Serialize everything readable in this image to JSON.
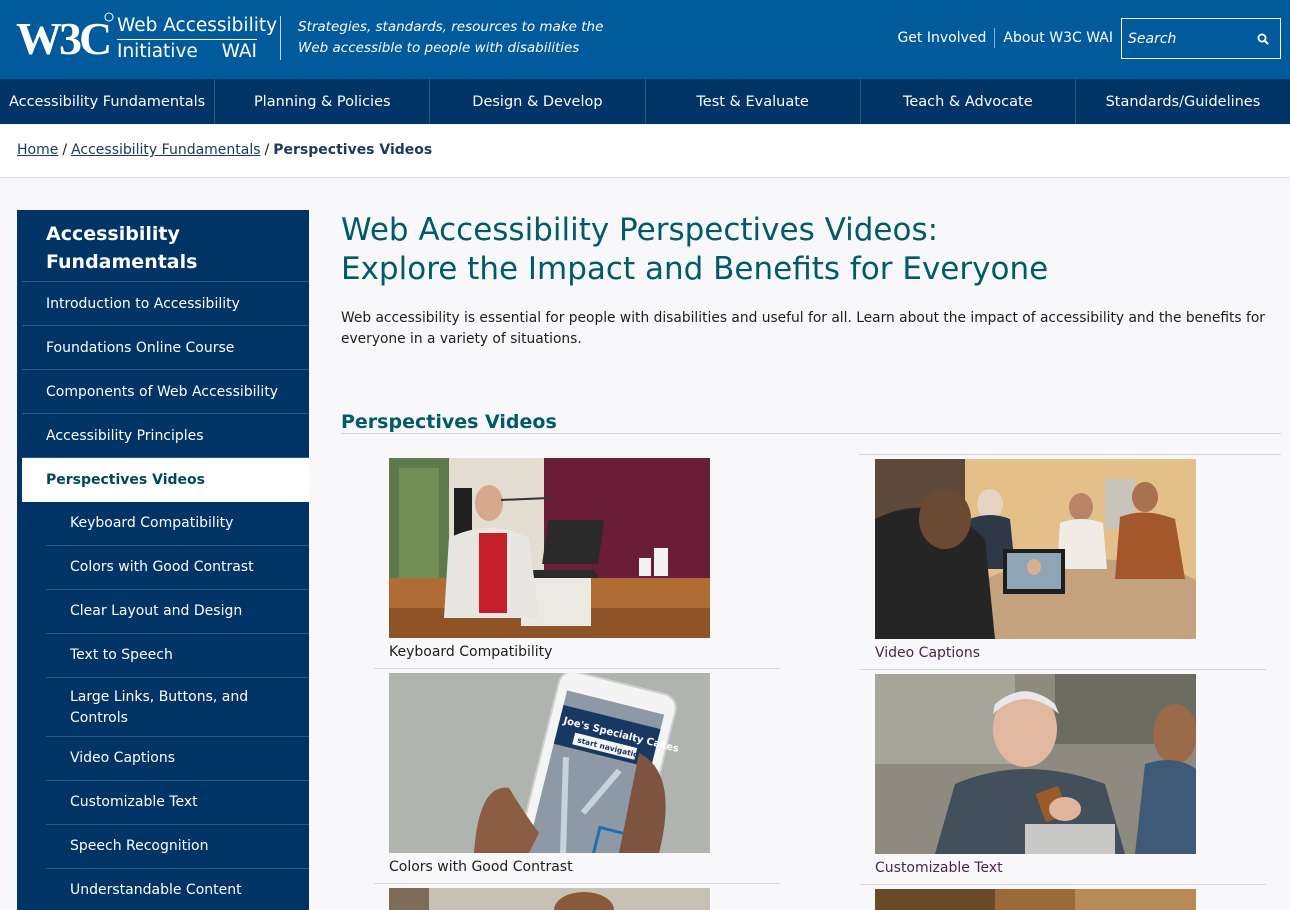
{
  "header": {
    "org_mark": "W3C",
    "title_line1": "Web Accessibility",
    "title_line2a": "Initiative",
    "title_line2b": "WAI",
    "tagline": "Strategies, standards, resources to make the Web accessible to people with disabilities",
    "links": [
      "Get Involved",
      "About W3C WAI"
    ],
    "search_placeholder": "Search"
  },
  "nav": {
    "items": [
      "Accessibility Fundamentals",
      "Planning & Policies",
      "Design & Develop",
      "Test & Evaluate",
      "Teach & Advocate",
      "Standards/Guidelines"
    ]
  },
  "breadcrumb": {
    "home": "Home",
    "section": "Accessibility Fundamentals",
    "current": "Perspectives Videos",
    "separator": "/"
  },
  "sidebar": {
    "title": "Accessibility Fundamentals",
    "items": [
      "Introduction to Accessibility",
      "Foundations Online Course",
      "Components of Web Accessibility",
      "Accessibility Principles"
    ],
    "active": "Perspectives Videos",
    "sub_items": [
      "Keyboard Compatibility",
      "Colors with Good Contrast",
      "Clear Layout and Design",
      "Text to Speech",
      "Large Links, Buttons, and Controls",
      "Video Captions",
      "Customizable Text",
      "Speech Recognition",
      "Understandable Content"
    ]
  },
  "main": {
    "title_line1": "Web Accessibility Perspectives Videos:",
    "title_line2": "Explore the Impact and Benefits for Everyone",
    "intro": "Web accessibility is essential for people with disabilities and useful for all. Learn about the impact of accessibility and the benefits for everyone in a variety of situations.",
    "section_heading": "Perspectives Videos",
    "videos": [
      {
        "caption": "Keyboard Compatibility"
      },
      {
        "caption": "Video Captions"
      },
      {
        "caption": "Colors with Good Contrast",
        "phone_title": "Joe's Specialty Cakes",
        "phone_button": "start navigation"
      },
      {
        "caption": "Customizable Text"
      }
    ]
  },
  "colors": {
    "header_blue": "#005a9c",
    "nav_navy": "#003366",
    "heading_teal": "#005a6a"
  }
}
